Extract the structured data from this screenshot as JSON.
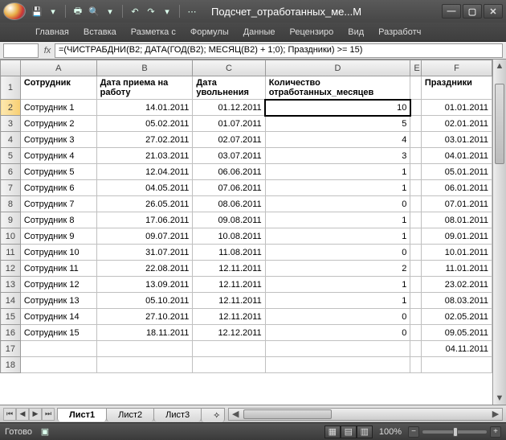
{
  "window": {
    "title": "Подсчет_отработанных_ме...M"
  },
  "ribbon": {
    "tabs": [
      "Главная",
      "Вставка",
      "Разметка с",
      "Формулы",
      "Данные",
      "Рецензиро",
      "Вид",
      "Разработч"
    ]
  },
  "formula_bar": {
    "name_box": "",
    "formula": "=(ЧИСТРАБДНИ(B2; ДАТА(ГОД(B2); МЕСЯЦ(B2) + 1;0); Праздники) >= 15)"
  },
  "columns": [
    "A",
    "B",
    "C",
    "D",
    "E",
    "F"
  ],
  "header": {
    "A": "Сотрудник",
    "B": "Дата приема на работу",
    "C": "Дата увольнения",
    "D": "Количество отработанных_месяцев",
    "E": "",
    "F": "Праздники"
  },
  "rows": [
    {
      "n": 2,
      "a": "Сотрудник 1",
      "b": "14.01.2011",
      "c": "01.12.2011",
      "d": "10",
      "f": "01.01.2011",
      "active": true
    },
    {
      "n": 3,
      "a": "Сотрудник 2",
      "b": "05.02.2011",
      "c": "01.07.2011",
      "d": "5",
      "f": "02.01.2011"
    },
    {
      "n": 4,
      "a": "Сотрудник 3",
      "b": "27.02.2011",
      "c": "02.07.2011",
      "d": "4",
      "f": "03.01.2011"
    },
    {
      "n": 5,
      "a": "Сотрудник 4",
      "b": "21.03.2011",
      "c": "03.07.2011",
      "d": "3",
      "f": "04.01.2011"
    },
    {
      "n": 6,
      "a": "Сотрудник 5",
      "b": "12.04.2011",
      "c": "06.06.2011",
      "d": "1",
      "f": "05.01.2011"
    },
    {
      "n": 7,
      "a": "Сотрудник 6",
      "b": "04.05.2011",
      "c": "07.06.2011",
      "d": "1",
      "f": "06.01.2011"
    },
    {
      "n": 8,
      "a": "Сотрудник 7",
      "b": "26.05.2011",
      "c": "08.06.2011",
      "d": "0",
      "f": "07.01.2011"
    },
    {
      "n": 9,
      "a": "Сотрудник 8",
      "b": "17.06.2011",
      "c": "09.08.2011",
      "d": "1",
      "f": "08.01.2011"
    },
    {
      "n": 10,
      "a": "Сотрудник 9",
      "b": "09.07.2011",
      "c": "10.08.2011",
      "d": "1",
      "f": "09.01.2011"
    },
    {
      "n": 11,
      "a": "Сотрудник 10",
      "b": "31.07.2011",
      "c": "11.08.2011",
      "d": "0",
      "f": "10.01.2011"
    },
    {
      "n": 12,
      "a": "Сотрудник 11",
      "b": "22.08.2011",
      "c": "12.11.2011",
      "d": "2",
      "f": "11.01.2011"
    },
    {
      "n": 13,
      "a": "Сотрудник 12",
      "b": "13.09.2011",
      "c": "12.11.2011",
      "d": "1",
      "f": "23.02.2011"
    },
    {
      "n": 14,
      "a": "Сотрудник 13",
      "b": "05.10.2011",
      "c": "12.11.2011",
      "d": "1",
      "f": "08.03.2011"
    },
    {
      "n": 15,
      "a": "Сотрудник 14",
      "b": "27.10.2011",
      "c": "12.11.2011",
      "d": "0",
      "f": "02.05.2011"
    },
    {
      "n": 16,
      "a": "Сотрудник 15",
      "b": "18.11.2011",
      "c": "12.12.2011",
      "d": "0",
      "f": "09.05.2011"
    },
    {
      "n": 17,
      "a": "",
      "b": "",
      "c": "",
      "d": "",
      "f": "04.11.2011"
    },
    {
      "n": 18,
      "a": "",
      "b": "",
      "c": "",
      "d": "",
      "f": ""
    }
  ],
  "sheets": {
    "tabs": [
      "Лист1",
      "Лист2",
      "Лист3"
    ],
    "active": 0
  },
  "status": {
    "ready": "Готово",
    "zoom": "100%"
  }
}
